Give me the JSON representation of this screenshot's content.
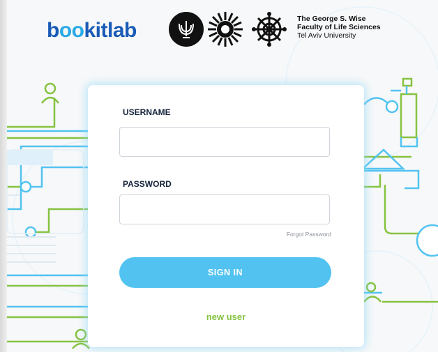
{
  "header": {
    "logo_prefix": "b",
    "logo_oo": "oo",
    "logo_suffix": "kitlab",
    "faculty_line1": "The George S. Wise",
    "faculty_line2": "Faculty of Life Sciences",
    "faculty_line3": "Tel Aviv University"
  },
  "login": {
    "username_label": "USERNAME",
    "username_value": "",
    "password_label": "PASSWORD",
    "password_value": "",
    "forgot_password": "Forgot Password",
    "sign_in": "SIGN IN",
    "new_user": "new user"
  },
  "colors": {
    "accent_blue": "#52c3f1",
    "accent_green": "#86c341",
    "brand_blue": "#1a5bb7"
  }
}
